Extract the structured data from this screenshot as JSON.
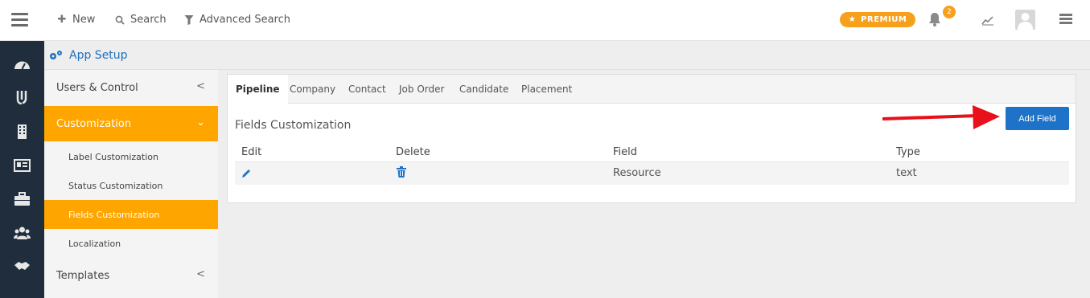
{
  "topbar": {
    "new_label": "New",
    "search_label": "Search",
    "advanced_search_label": "Advanced Search",
    "premium_label": "PREMIUM",
    "notification_count": "2"
  },
  "app_header": {
    "title": "App Setup"
  },
  "sidenav": {
    "users_control": "Users & Control",
    "customization": "Customization",
    "sub_items": [
      "Label Customization",
      "Status Customization",
      "Fields Customization",
      "Localization"
    ],
    "templates": "Templates"
  },
  "tabs": [
    "Pipeline",
    "Company",
    "Contact",
    "Job Order",
    "Candidate",
    "Placement"
  ],
  "content": {
    "title": "Fields Customization",
    "add_field_label": "Add Field",
    "columns": [
      "Edit",
      "Delete",
      "Field",
      "Type"
    ],
    "rows": [
      {
        "field": "Resource",
        "type": "text"
      }
    ]
  },
  "colors": {
    "accent_orange": "#ffa500",
    "primary_blue": "#1e73c8",
    "rail_dark": "#1f2d3d",
    "arrow_red": "#e8101a"
  }
}
